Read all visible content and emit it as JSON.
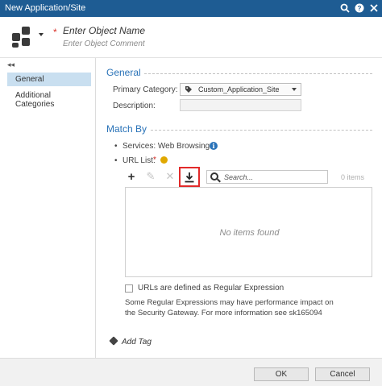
{
  "window": {
    "title": "New Application/Site"
  },
  "header": {
    "name_placeholder": "Enter Object Name",
    "comment_placeholder": "Enter Object Comment"
  },
  "sidebar": {
    "items": [
      {
        "label": "General"
      },
      {
        "label": "Additional Categories"
      }
    ]
  },
  "general": {
    "heading": "General",
    "primary_category_label": "Primary Category:",
    "primary_category_value": "Custom_Application_Site",
    "description_label": "Description:"
  },
  "match_by": {
    "heading": "Match By",
    "services_text": "Services: Web Browsing",
    "url_list_label": "URL List:",
    "search_placeholder": "Search...",
    "items_count": "0 items",
    "empty_text": "No items found",
    "regex_label": "URLs are defined as Regular Expression",
    "regex_note": "Some Regular Expressions may have performance impact on the Security Gateway. For more information see sk165094"
  },
  "add_tag_label": "Add Tag",
  "footer": {
    "ok_label": "OK",
    "cancel_label": "Cancel"
  }
}
